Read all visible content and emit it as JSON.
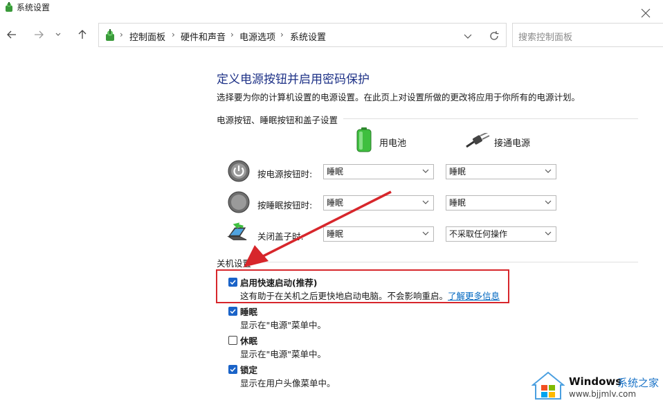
{
  "window": {
    "title": "系统设置",
    "close_icon": "close-icon"
  },
  "nav": {
    "back_icon": "arrow-left-icon",
    "forward_icon": "arrow-right-icon",
    "recent_icon": "chevron-down-icon",
    "up_icon": "arrow-up-icon"
  },
  "address": {
    "crumbs": [
      "控制面板",
      "硬件和声音",
      "电源选项",
      "系统设置"
    ],
    "separator": "›"
  },
  "search": {
    "placeholder": "搜索控制面板"
  },
  "main": {
    "title": "定义电源按钮并启用密码保护",
    "description": "选择要为你的计算机设置的电源设置。在此页上对设置所做的更改将应用于你所有的电源计划。",
    "power_section": {
      "label": "电源按钮、睡眠按钮和盖子设置",
      "columns": {
        "battery": "用电池",
        "plugged": "接通电源"
      },
      "rows": [
        {
          "label": "按电源按钮时:",
          "icon": "power-button-icon",
          "battery": "睡眠",
          "plugged": "睡眠"
        },
        {
          "label": "按睡眠按钮时:",
          "icon": "sleep-button-icon",
          "battery": "睡眠",
          "plugged": "睡眠"
        },
        {
          "label": "关闭盖子时:",
          "icon": "laptop-lid-icon",
          "battery": "睡眠",
          "plugged": "不采取任何操作"
        }
      ]
    },
    "shutdown_section": {
      "label": "关机设置",
      "options": [
        {
          "title": "启用快速启动(推荐)",
          "desc": "这有助于在关机之后更快地启动电脑。不会影响重启。",
          "link": "了解更多信息",
          "checked": true
        },
        {
          "title": "睡眠",
          "desc": "显示在\"电源\"菜单中。",
          "checked": true
        },
        {
          "title": "休眠",
          "desc": "显示在\"电源\"菜单中。",
          "checked": false
        },
        {
          "title": "锁定",
          "desc": "显示在用户头像菜单中。",
          "checked": true
        }
      ]
    }
  },
  "watermark": {
    "brand": "Windows",
    "brand_suffix": "系统之家",
    "url": "www.bjjmlv.com"
  },
  "colors": {
    "accent": "#1a63c8",
    "title": "#1e3287",
    "link": "#0067c0",
    "highlight": "#d7262b"
  }
}
